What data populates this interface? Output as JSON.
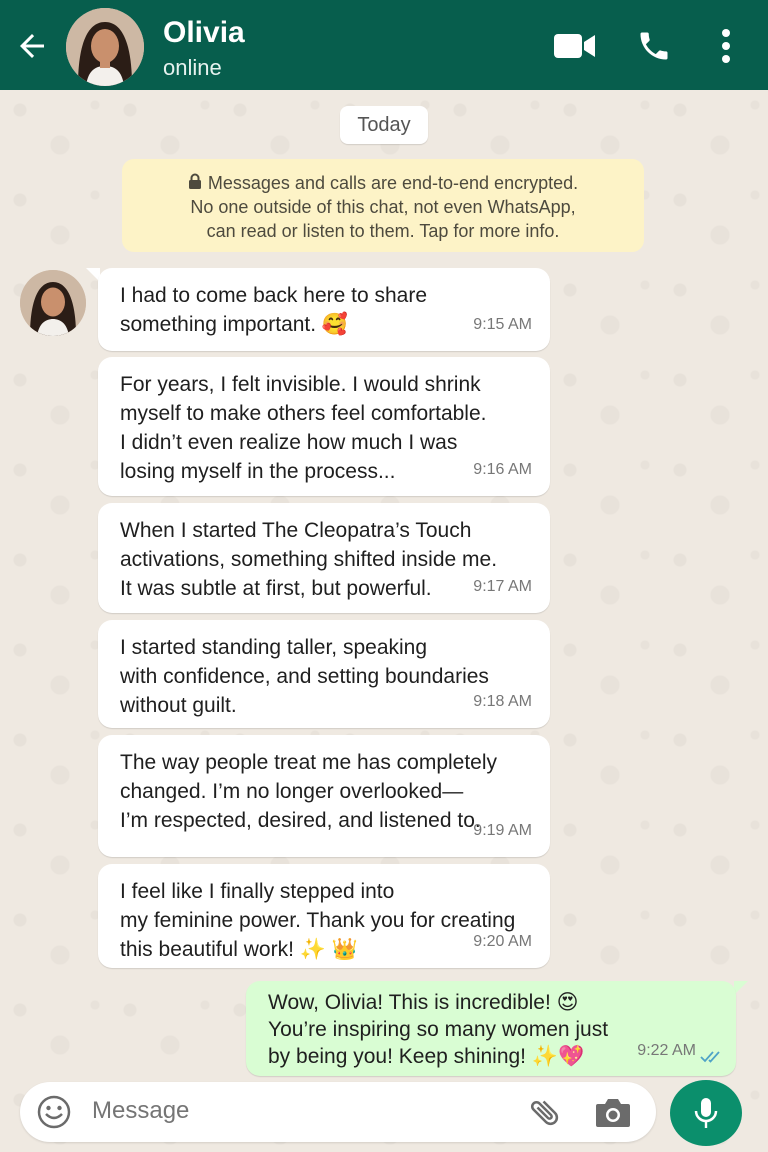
{
  "header": {
    "contact_name": "Olivia",
    "status": "online",
    "back_icon": "arrow-left-icon",
    "icons": [
      "video-call-icon",
      "phone-icon",
      "more-vertical-icon"
    ],
    "color": "#075e4d"
  },
  "chat": {
    "date_label": "Today",
    "encryption_notice": "Messages and calls are end-to-end encrypted.\nNo one outside of this chat, not even WhatsApp,\ncan read or listen to them. Tap for more info.",
    "messages": [
      {
        "direction": "in",
        "text": "I had to come back here to share\nsomething important. 🥰",
        "time": "9:15 AM"
      },
      {
        "direction": "in",
        "text": "For years, I felt invisible. I would shrink\nmyself to make others feel comfortable.\nI didn’t even realize how much I was\nlosing myself in the process...",
        "time": "9:16 AM"
      },
      {
        "direction": "in",
        "text": "When I started The Cleopatra’s Touch\nactivations, something shifted inside me.\nIt was subtle at first, but powerful.",
        "time": "9:17 AM"
      },
      {
        "direction": "in",
        "text": "I started standing taller, speaking\nwith confidence, and setting boundaries\nwithout guilt.",
        "time": "9:18 AM"
      },
      {
        "direction": "in",
        "text": "The way people treat me has completely\nchanged. I’m no longer overlooked—\nI’m respected, desired, and listened to.",
        "time": "9:19 AM"
      },
      {
        "direction": "in",
        "text": "I feel like I finally stepped into\nmy feminine power. Thank you for creating\nthis beautiful work! ✨ 👑",
        "time": "9:20 AM"
      },
      {
        "direction": "out",
        "text": "Wow, Olivia! This is incredible! 😍\nYou’re inspiring so many women just\nby being you! Keep shining! ✨💖",
        "time": "9:22 AM",
        "read": true
      }
    ]
  },
  "composer": {
    "placeholder": "Message",
    "icons": [
      "emoji-icon",
      "attach-icon",
      "camera-icon",
      "mic-icon"
    ],
    "accent": "#0b8f6c"
  }
}
